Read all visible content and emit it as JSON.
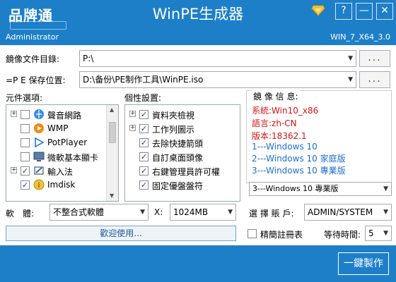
{
  "window": {
    "logo_text": "品牌通",
    "title": "WinPE生成器",
    "user": "Administrator",
    "version": "WIN_7_X64_3.0",
    "help_label": "?",
    "minimize_label": "—",
    "close_label": "✕"
  },
  "image_file": {
    "label": "鏡像文件目錄:",
    "value": "P:\\",
    "browse_label": "..."
  },
  "pe_save": {
    "label": "=P E 保存位置:",
    "value": "D:\\备份\\PE制作工具\\WinPE.iso",
    "browse_label": "..."
  },
  "components": {
    "label": "元件選項:",
    "items": [
      {
        "label": "聲音網路",
        "checked": false,
        "expandable": true,
        "icon": "network-icon"
      },
      {
        "label": "WMP",
        "checked": false,
        "expandable": false,
        "icon": "wmp-icon"
      },
      {
        "label": "PotPlayer",
        "checked": false,
        "expandable": false,
        "icon": "potplayer-icon"
      },
      {
        "label": "微軟基本顯卡",
        "checked": false,
        "expandable": false,
        "icon": "display-icon"
      },
      {
        "label": "輸入法",
        "checked": true,
        "expandable": true,
        "icon": "ime-icon"
      },
      {
        "label": "Imdisk",
        "checked": true,
        "expandable": false,
        "icon": "imdisk-icon"
      }
    ]
  },
  "personal": {
    "label": "個性設置:",
    "items": [
      {
        "label": "資料夾檢視",
        "checked": true,
        "expandable": true
      },
      {
        "label": "工作列圖示",
        "checked": true,
        "expandable": true
      },
      {
        "label": "去除快捷箭頭",
        "checked": true,
        "expandable": false
      },
      {
        "label": "自訂桌面頭像",
        "checked": true,
        "expandable": false
      },
      {
        "label": "右鍵管理員許可權",
        "checked": true,
        "expandable": false
      },
      {
        "label": "固定優盤盤符",
        "checked": true,
        "expandable": false
      }
    ]
  },
  "image_info": {
    "label": "鏡 像 信 息:",
    "red_lines": [
      "系統:Win10_x86",
      "語言:zh-CN",
      "版本:18362.1"
    ],
    "blue_lines": [
      "1---Windows 10",
      "2---Windows 10 家庭版",
      "3---Windows 10 專業版"
    ],
    "selected": "3---Windows 10 專業版"
  },
  "software": {
    "label": "軟　體:",
    "value": "不整合式軟體"
  },
  "resolution": {
    "label": "X:",
    "value": "1024MB"
  },
  "account": {
    "label": "選 擇 賬 戶:",
    "value": "ADMIN/SYSTEM"
  },
  "welcome_label": "歡迎使用...",
  "registry": {
    "label": "精簡註冊表",
    "checked": false
  },
  "wait": {
    "label": "等待時間:",
    "value": "5"
  },
  "make_label": "一鍵製作",
  "colors": {
    "titlebar": "#1e7fc9",
    "red_info": "#d11111",
    "blue_info": "#1a6fd0"
  }
}
